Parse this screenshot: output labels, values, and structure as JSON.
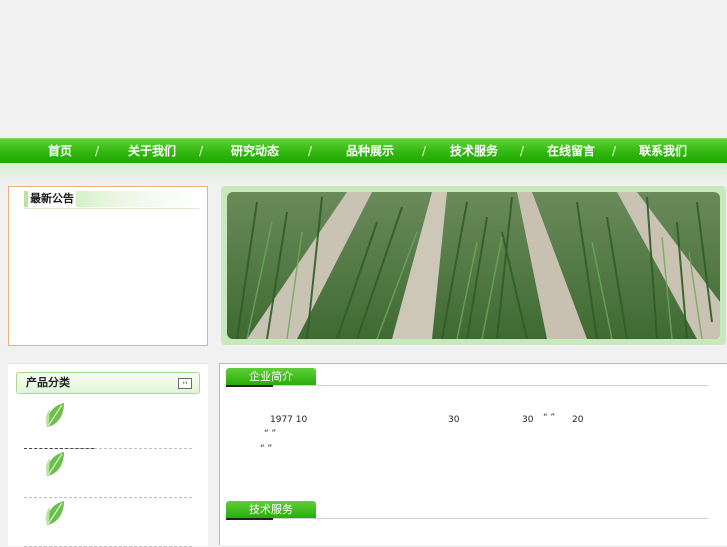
{
  "nav": {
    "items": [
      "首页",
      "关于我们",
      "研究动态",
      "品种展示",
      "技术服务",
      "在线留言",
      "联系我们"
    ],
    "separator": "/"
  },
  "notice": {
    "title": "最新公告"
  },
  "category": {
    "title": "产品分类",
    "more_label": "››"
  },
  "about": {
    "title": "企业简介",
    "fragments": [
      "1977 10",
      "30",
      "30",
      "“ ”",
      "20",
      "“     ”",
      "“     ”"
    ]
  },
  "service": {
    "title": "技术服务"
  },
  "colors": {
    "accent": "#31b80f",
    "notice_border": "#f0b070"
  },
  "icons": {
    "category_item": "leaf-icon"
  }
}
